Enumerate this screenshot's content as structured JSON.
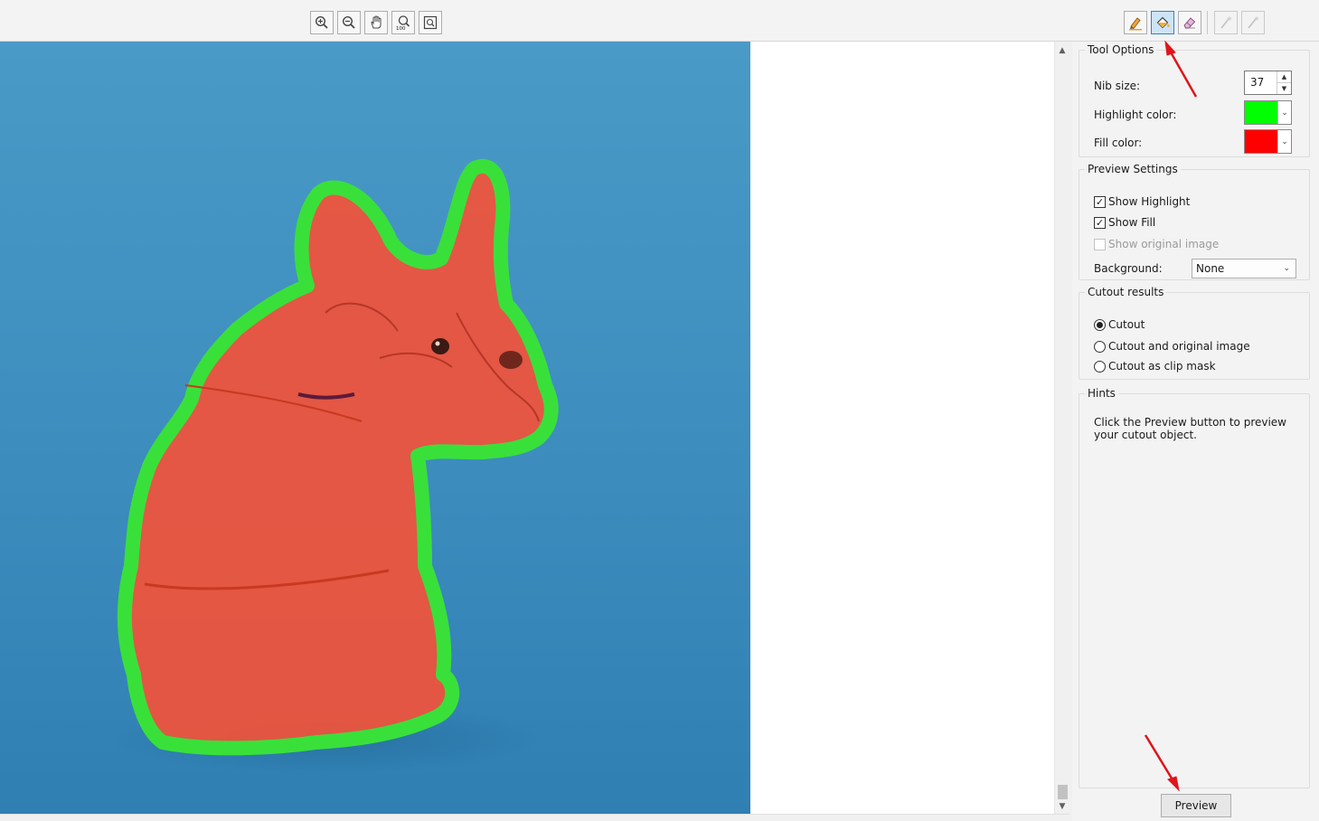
{
  "toolbar": {
    "zoom_icons": [
      "zoom-in-icon",
      "zoom-out-icon",
      "hand-icon",
      "zoom-100-icon",
      "fit-screen-icon"
    ],
    "zoom100_text": "100",
    "tools": [
      "highlight-marker-icon",
      "fill-bucket-icon",
      "eraser-icon",
      "magic-wand-icon",
      "magic-wand-icon"
    ],
    "active_tool": "fill-bucket-icon"
  },
  "tool_options": {
    "title": "Tool Options",
    "nib_size_label": "Nib size:",
    "nib_size_value": "37",
    "highlight_color_label": "Highlight color:",
    "highlight_color": "#00ff00",
    "fill_color_label": "Fill color:",
    "fill_color": "#ff0000"
  },
  "preview_settings": {
    "title": "Preview Settings",
    "show_highlight_label": "Show Highlight",
    "show_highlight_checked": true,
    "show_fill_label": "Show Fill",
    "show_fill_checked": true,
    "show_original_label": "Show original image",
    "show_original_checked": false,
    "background_label": "Background:",
    "background_value": "None"
  },
  "cutout_results": {
    "title": "Cutout results",
    "options": [
      "Cutout",
      "Cutout and original image",
      "Cutout as clip mask"
    ],
    "selected": "Cutout"
  },
  "hints": {
    "title": "Hints",
    "text": "Click the Preview button to preview your cutout object."
  },
  "preview_button_label": "Preview",
  "colors": {
    "photo_background": "#3f8dbd",
    "fill_overlay": "#f0533a",
    "highlight_outline": "#39e03a",
    "annotation_arrow": "#e0141b"
  }
}
